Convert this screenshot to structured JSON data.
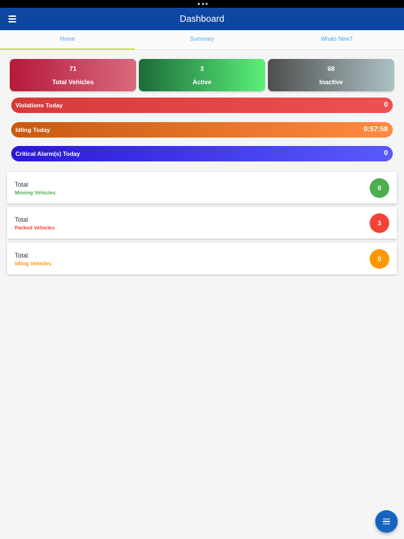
{
  "app_bar": {
    "title": "Dashboard",
    "menu_icon": "menu-icon"
  },
  "tabs": [
    {
      "label": "Home",
      "active": true
    },
    {
      "label": "Summary",
      "active": false
    },
    {
      "label": "Whats New?",
      "active": false
    }
  ],
  "stats": {
    "total": {
      "value": "71",
      "label": "Total Vehicles"
    },
    "active": {
      "value": "3",
      "label": "Active"
    },
    "inactive": {
      "value": "68",
      "label": "Inactive"
    }
  },
  "bars": {
    "violations": {
      "label": "Violations Today",
      "value": "0"
    },
    "idling": {
      "label": "Idling Today",
      "value": "0:57:58"
    },
    "alarms": {
      "label": "Critical Alarm(s) Today",
      "value": "0"
    }
  },
  "vehicle_summary": {
    "moving": {
      "title": "Total",
      "subtitle": "Moving Vehicles",
      "count": "0"
    },
    "parked": {
      "title": "Total",
      "subtitle": "Parked Vehicles",
      "count": "3"
    },
    "idling": {
      "title": "Total",
      "subtitle": "Idling Vehicles",
      "count": "0"
    }
  },
  "colors": {
    "primary": "#0d47a1",
    "tab_text": "#42a5f5",
    "tab_indicator": "#c6e03a",
    "moving": "#4caf50",
    "parked": "#f44336",
    "idling": "#ff9800",
    "fab": "#1565c0"
  },
  "fab": {
    "icon": "menu-icon"
  }
}
